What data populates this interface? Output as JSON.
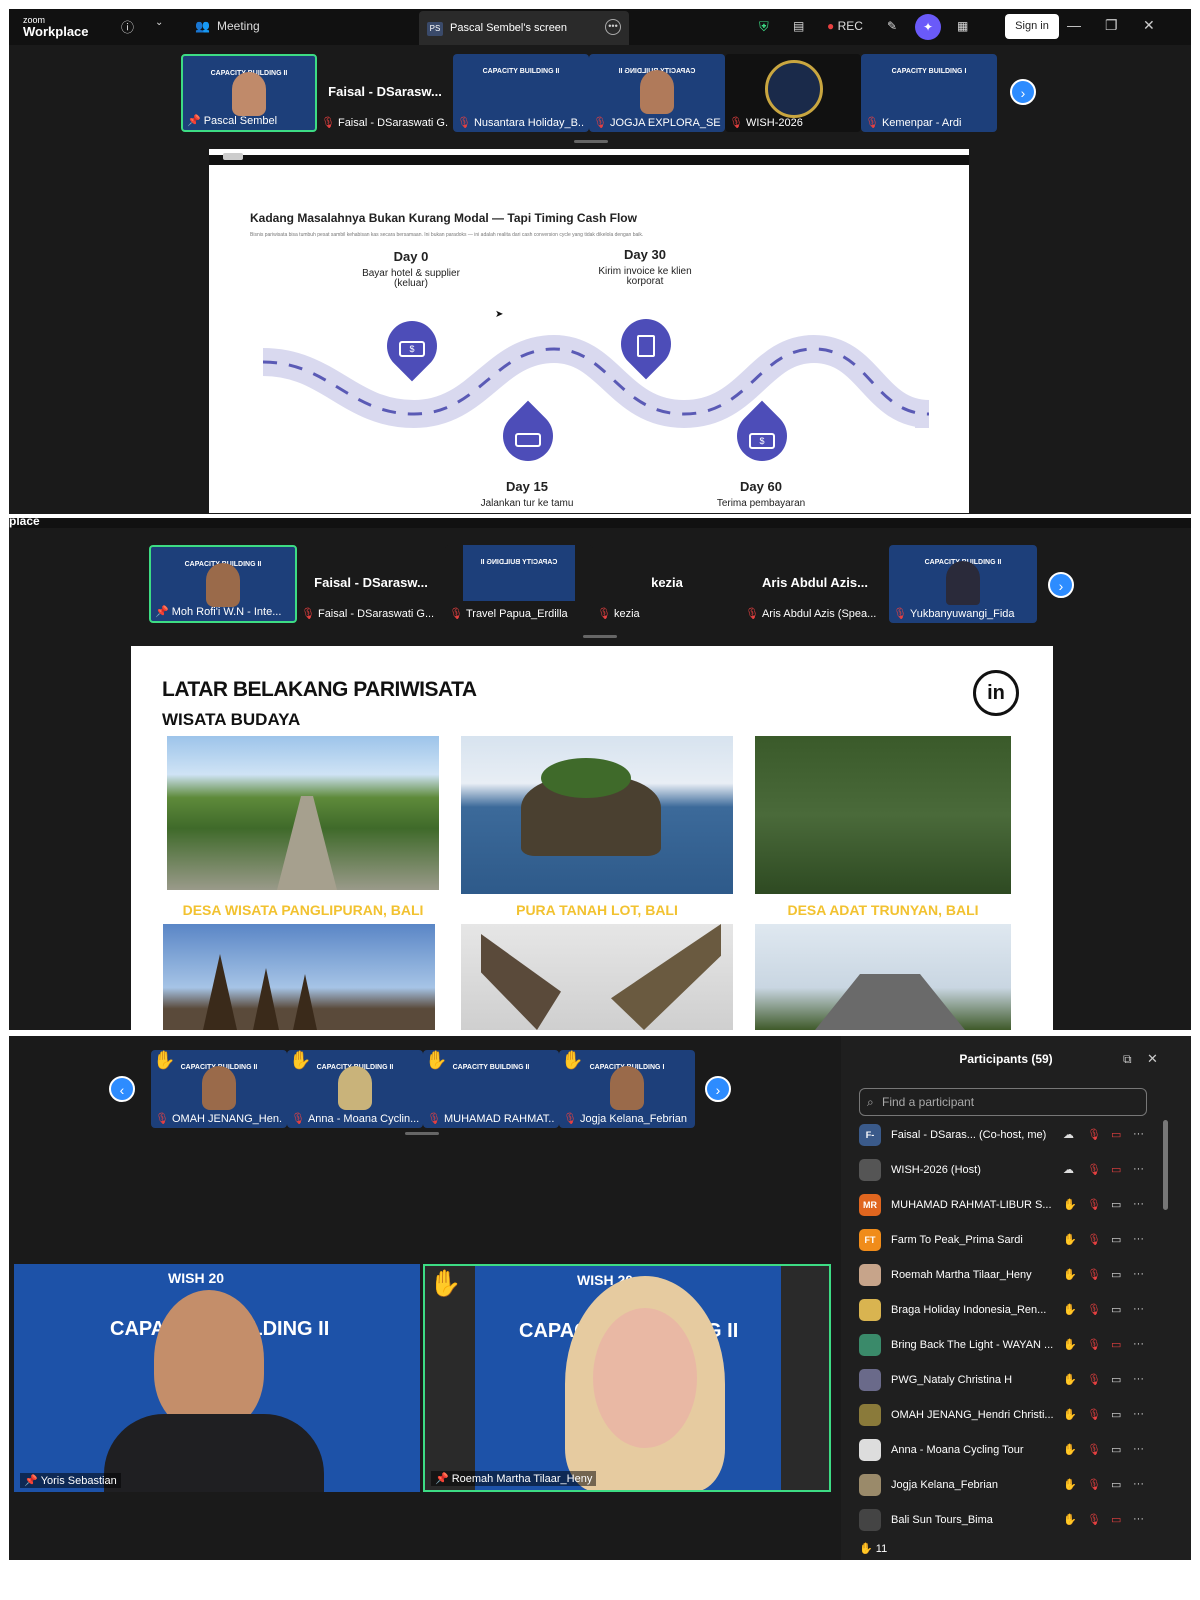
{
  "topbar": {
    "logo_small": "zoom",
    "logo_big": "Workplace",
    "meeting_label": "Meeting",
    "tab_badge": "PS",
    "tab_title": "Pascal Sembel's screen",
    "rec_label": "REC",
    "signin_label": "Sign in",
    "partial_logo": "place"
  },
  "strip1": [
    {
      "name": "Pascal Sembel",
      "pinned": true,
      "caption": "CAPACITY BUILDING II"
    },
    {
      "name": "Faisal - DSaraswati G...",
      "bigname": "Faisal - DSarasw..."
    },
    {
      "name": "Nusantara Holiday_B...",
      "caption": "CAPACITY BUILDING II"
    },
    {
      "name": "JOGJA EXPLORA_SETI...",
      "caption": "CAPACITY BUILDING II"
    },
    {
      "name": "WISH-2026"
    },
    {
      "name": "Kemenpar - Ardi",
      "caption": "CAPACITY BUILDING I"
    }
  ],
  "slide1": {
    "title": "Kadang Masalahnya Bukan Kurang Modal — Tapi Timing Cash Flow",
    "subtitle": "Bisnis pariwisata bisa tumbuh pesat sambil kehabisan kas secara bersamaan. Ini bukan paradoks — ini adalah realita dari cash conversion cycle yang tidak dikelola dengan baik.",
    "days": [
      {
        "day": "Day 0",
        "desc": "Bayar hotel & supplier (keluar)"
      },
      {
        "day": "Day 30",
        "desc": "Kirim invoice ke klien korporat"
      },
      {
        "day": "Day 15",
        "desc": "Jalankan tur ke tamu"
      },
      {
        "day": "Day 60",
        "desc": "Terima pembayaran"
      }
    ]
  },
  "strip2": [
    {
      "name": "Moh Rofi'i W.N - Inte...",
      "pinned": true,
      "caption": "CAPACITY BUILDING II"
    },
    {
      "name": "Faisal - DSaraswati G...",
      "bigname": "Faisal - DSarasw..."
    },
    {
      "name": "Travel Papua_Erdilla",
      "caption": "CAPACITY BUILDING II"
    },
    {
      "name": "kezia",
      "bigname": "kezia"
    },
    {
      "name": "Aris Abdul Azis (Spea...",
      "bigname": "Aris Abdul Azis..."
    },
    {
      "name": "Yukbanyuwangi_Fida",
      "caption": "CAPACITY BUILDING II"
    }
  ],
  "slide2": {
    "title": "LATAR BELAKANG PARIWISATA",
    "subtitle": "WISATA BUDAYA",
    "logo": "in",
    "captions": [
      "DESA WISATA PANGLIPURAN, BALI",
      "PURA TANAH LOT, BALI",
      "DESA ADAT TRUNYAN, BALI"
    ]
  },
  "strip3": [
    {
      "name": "OMAH JENANG_Hen...",
      "caption": "CAPACITY BUILDING II"
    },
    {
      "name": "Anna - Moana Cyclin...",
      "caption": "CAPACITY BUILDING II"
    },
    {
      "name": "MUHAMAD RAHMAT...",
      "caption": "CAPACITY BUILDING II"
    },
    {
      "name": "Jogja Kelana_Febrian",
      "caption": "CAPACITY BUILDING I"
    }
  ],
  "videos": [
    {
      "name": "Yoris Sebastian",
      "caption": "CAPACITY BUILDING II",
      "wish": "WISH 20"
    },
    {
      "name": "Roemah Martha Tilaar_Heny",
      "caption": "CAPACITY BUILDING II",
      "wish": "WISH 20"
    }
  ],
  "participants": {
    "title": "Participants (59)",
    "search_placeholder": "Find a participant",
    "raised_count": "11",
    "list": [
      {
        "initials": "F-",
        "name": "Faisal - DSaras... (Co-host, me)",
        "color": "#3a5a8a"
      },
      {
        "initials": "",
        "name": "WISH-2026 (Host)",
        "color": "#555555"
      },
      {
        "initials": "MR",
        "name": "MUHAMAD RAHMAT-LIBUR S...",
        "color": "#e0661f"
      },
      {
        "initials": "FT",
        "name": "Farm To Peak_Prima Sardi",
        "color": "#f08c1a"
      },
      {
        "initials": "",
        "name": "Roemah Martha Tilaar_Heny",
        "color": "#c7a48a"
      },
      {
        "initials": "",
        "name": "Braga Holiday Indonesia_Ren...",
        "color": "#d9b450"
      },
      {
        "initials": "",
        "name": "Bring Back The Light - WAYAN ...",
        "color": "#3a8a6a"
      },
      {
        "initials": "",
        "name": "PWG_Nataly Christina H",
        "color": "#6a6a8a"
      },
      {
        "initials": "",
        "name": "OMAH JENANG_Hendri Christi...",
        "color": "#8a7a3a"
      },
      {
        "initials": "",
        "name": "Anna - Moana Cycling Tour",
        "color": "#dddddd"
      },
      {
        "initials": "",
        "name": "Jogja Kelana_Febrian",
        "color": "#9a8a6a"
      },
      {
        "initials": "",
        "name": "Bali Sun Tours_Bima",
        "color": "#444444"
      }
    ]
  }
}
